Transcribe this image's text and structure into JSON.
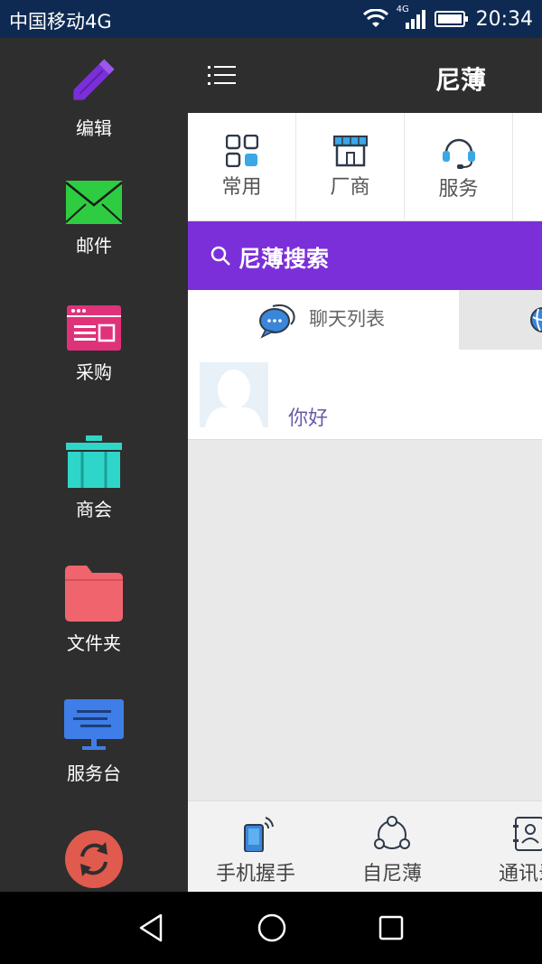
{
  "status_bar": {
    "carrier": "中国移动4G",
    "network_badge": "4G",
    "time": "20:34",
    "icons": [
      "wifi-icon",
      "signal-icon",
      "battery-icon"
    ]
  },
  "sidebar": {
    "items": [
      {
        "label": "编辑",
        "icon": "pencil-icon",
        "color": "#7b2fd9"
      },
      {
        "label": "邮件",
        "icon": "mail-icon",
        "color": "#2ecc40"
      },
      {
        "label": "采购",
        "icon": "browser-window-icon",
        "color": "#e0327a"
      },
      {
        "label": "商会",
        "icon": "box-icon",
        "color": "#2ed6c9"
      },
      {
        "label": "文件夹",
        "icon": "folder-icon",
        "color": "#f0646e"
      },
      {
        "label": "服务台",
        "icon": "monitor-icon",
        "color": "#3f7ee8"
      },
      {
        "label": "",
        "icon": "refresh-icon",
        "color": "#e05a4e"
      }
    ]
  },
  "header": {
    "title": "尼薄",
    "menu_icon": "menu-icon"
  },
  "quick_nav": {
    "items": [
      {
        "label": "常用",
        "icon": "grid-icon"
      },
      {
        "label": "厂商",
        "icon": "shop-icon"
      },
      {
        "label": "服务",
        "icon": "headset-icon"
      }
    ]
  },
  "search": {
    "label": "尼薄搜索",
    "color": "#7b2fd9"
  },
  "tabs": {
    "active_label": "聊天列表",
    "active_icon": "chat-bubble-icon",
    "second_icon": "globe-icon"
  },
  "chat_list": [
    {
      "message": "你好",
      "avatar": "default-avatar"
    }
  ],
  "bottom_nav": {
    "items": [
      {
        "label": "手机握手",
        "icon": "phone-signal-icon"
      },
      {
        "label": "自尼薄",
        "icon": "share-circle-icon"
      },
      {
        "label": "通讯录",
        "icon": "contacts-icon"
      }
    ]
  },
  "system_nav": [
    "back-button",
    "home-button",
    "recents-button"
  ]
}
